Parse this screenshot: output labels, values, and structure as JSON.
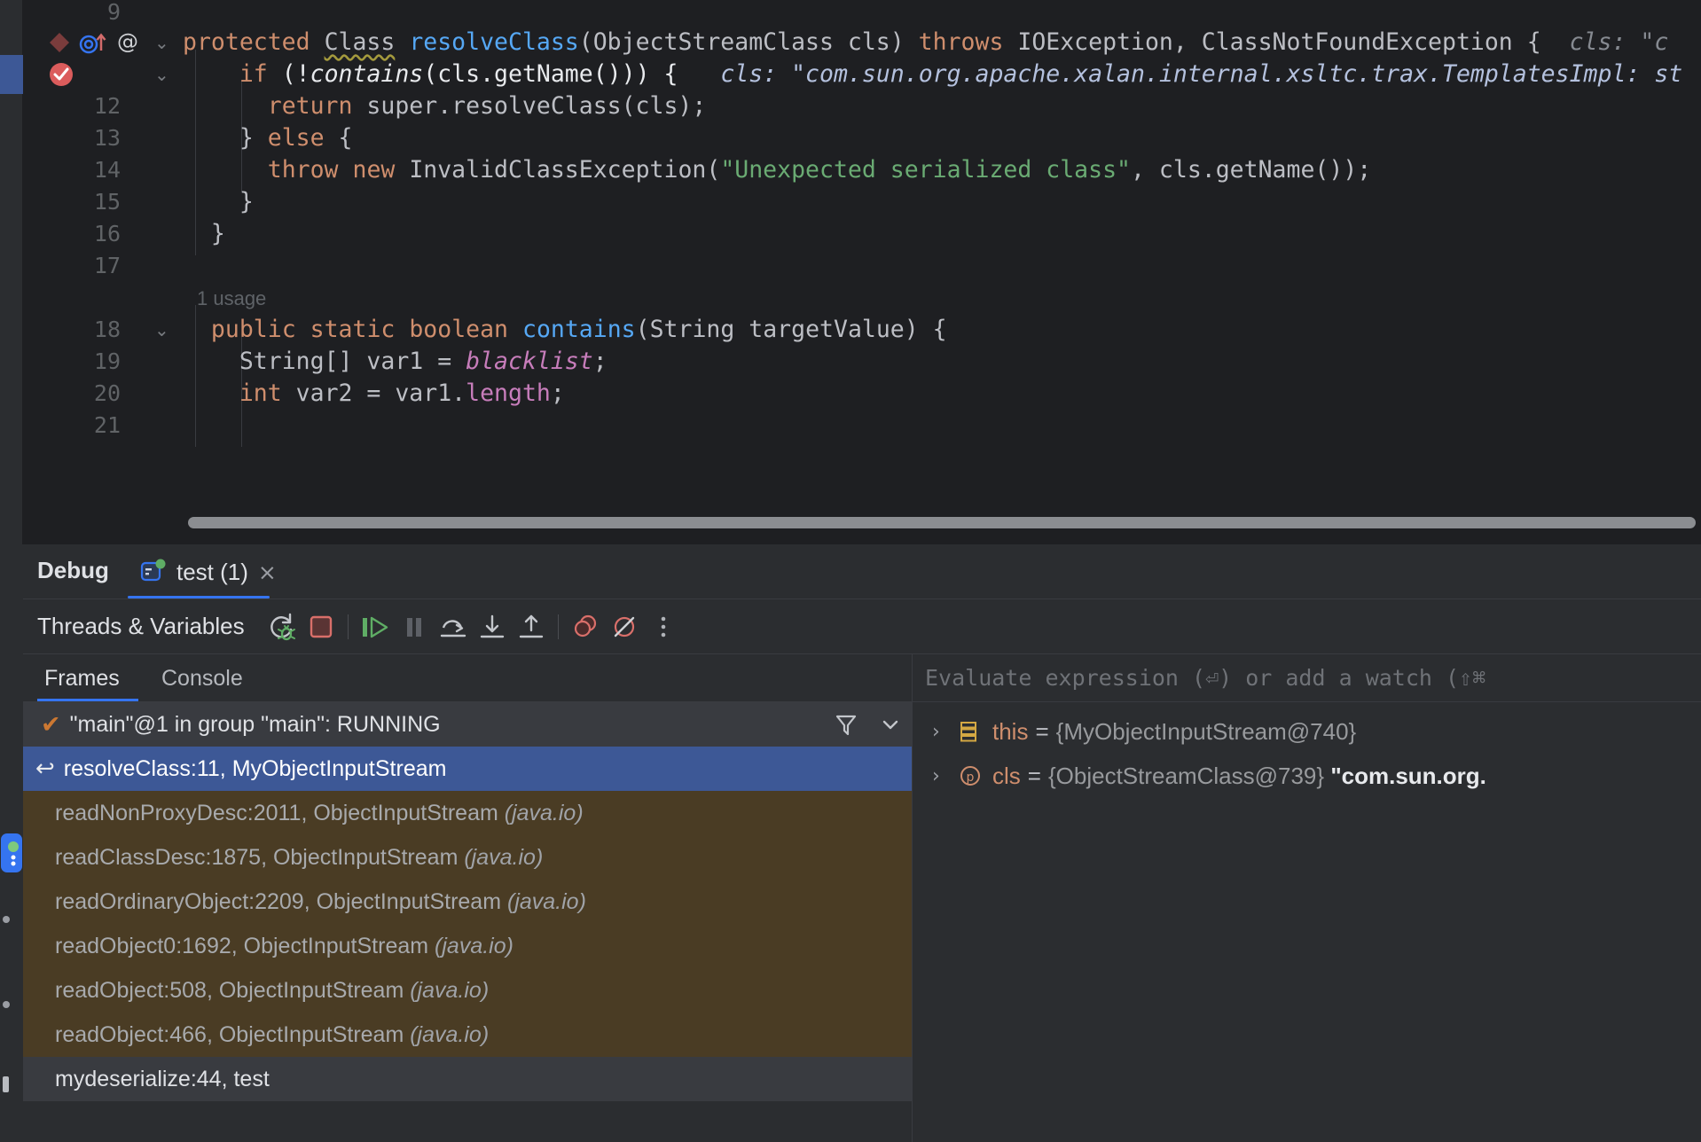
{
  "editor": {
    "lines": [
      {
        "num": "9",
        "tokens": []
      },
      {
        "num": "",
        "gutter": [
          "diamond-breakpoint-icon",
          "overriding-method-icon",
          "annotation-icon"
        ],
        "code": "protected Class resolveClass(ObjectStreamClass cls) throws IOException, ClassNotFoundException {",
        "inlay": "cls: \"c"
      },
      {
        "num": "",
        "gutter": [
          "breakpoint-verified-icon"
        ],
        "code": "if (!contains(cls.getName())) {",
        "inlay": "cls: \"com.sun.org.apache.xalan.internal.xsltc.trax.TemplatesImpl: st",
        "selected": true
      },
      {
        "num": "12",
        "code": "return super.resolveClass(cls);"
      },
      {
        "num": "13",
        "code": "} else {"
      },
      {
        "num": "14",
        "code": "throw new InvalidClassException(\"Unexpected serialized class\", cls.getName());"
      },
      {
        "num": "15",
        "code": "}"
      },
      {
        "num": "16",
        "code": "}"
      },
      {
        "num": "17",
        "code": ""
      },
      {
        "num": "",
        "code": "1 usage"
      },
      {
        "num": "18",
        "code": "public static boolean contains(String targetValue) {"
      },
      {
        "num": "19",
        "code": "String[] var1 = blacklist;"
      },
      {
        "num": "20",
        "code": "int var2 = var1.length;"
      },
      {
        "num": "21",
        "code": ""
      }
    ],
    "usage_hint": "1 usage",
    "line_numbers": [
      "9",
      "12",
      "13",
      "14",
      "15",
      "16",
      "17",
      "18",
      "19",
      "20",
      "21"
    ],
    "code_text": {
      "l10_kw1": "protected",
      "l10_type": "Class",
      "l10_fn": "resolveClass",
      "l10_params": "(ObjectStreamClass cls) ",
      "l10_kw2": "throws",
      "l10_rest": " IOException, ClassNotFoundException {",
      "l10_inlay": "cls: \"c",
      "l11_kw": "if",
      "l11_a": " (!",
      "l11_fn": "contains",
      "l11_b": "(cls.getName())) {",
      "l11_inlay": "cls: \"com.sun.org.apache.xalan.internal.xsltc.trax.TemplatesImpl: st",
      "l12_kw": "return",
      "l12_rest": " super.resolveClass(cls);",
      "l13_a": "} ",
      "l13_kw": "else",
      "l13_b": " {",
      "l14_kw1": "throw",
      "l14_kw2": "new",
      "l14_cls": " InvalidClassException(",
      "l14_str": "\"Unexpected serialized class\"",
      "l14_rest": ", cls.getName());",
      "l15": "}",
      "l16": "}",
      "l18_kw1": "public",
      "l18_kw2": "static",
      "l18_kw3": "boolean",
      "l18_fn": "contains",
      "l18_rest": "(String targetValue) {",
      "l19_a": "String[] var1 = ",
      "l19_fld": "blacklist",
      "l19_b": ";",
      "l20_kw": "int",
      "l20_a": " var2 = var1.",
      "l20_fld": "length",
      "l20_b": ";"
    }
  },
  "debug": {
    "window_title": "Debug",
    "session_tab": {
      "label": "test (1)",
      "icon": "run-configuration-icon",
      "close": "×"
    },
    "toolbar": {
      "label": "Threads & Variables",
      "buttons": [
        {
          "name": "rerun-debug-button",
          "tooltip": "Rerun Debug"
        },
        {
          "name": "stop-button",
          "tooltip": "Stop"
        },
        {
          "name": "resume-program-button",
          "tooltip": "Resume Program"
        },
        {
          "name": "pause-program-button",
          "tooltip": "Pause Program"
        },
        {
          "name": "step-over-button",
          "tooltip": "Step Over"
        },
        {
          "name": "step-into-button",
          "tooltip": "Step Into"
        },
        {
          "name": "step-out-button",
          "tooltip": "Step Out"
        },
        {
          "name": "view-breakpoints-button",
          "tooltip": "View Breakpoints"
        },
        {
          "name": "mute-breakpoints-button",
          "tooltip": "Mute Breakpoints"
        },
        {
          "name": "more-options-button",
          "tooltip": "More"
        }
      ]
    },
    "sub_tabs": [
      {
        "label": "Frames",
        "active": true
      },
      {
        "label": "Console",
        "active": false
      }
    ],
    "thread_selector": {
      "text": "\"main\"@1 in group \"main\": RUNNING",
      "status_icon": "check-icon",
      "filter_icon": "filter-funnel-icon",
      "dropdown_icon": "chevron-down-icon"
    },
    "frames": [
      {
        "text": "resolveClass:11, MyObjectInputStream",
        "pkg": "",
        "style": "selected"
      },
      {
        "text": "readNonProxyDesc:2011, ObjectInputStream",
        "pkg": "(java.io)",
        "style": "lib"
      },
      {
        "text": "readClassDesc:1875, ObjectInputStream",
        "pkg": "(java.io)",
        "style": "lib"
      },
      {
        "text": "readOrdinaryObject:2209, ObjectInputStream",
        "pkg": "(java.io)",
        "style": "lib"
      },
      {
        "text": "readObject0:1692, ObjectInputStream",
        "pkg": "(java.io)",
        "style": "lib"
      },
      {
        "text": "readObject:508, ObjectInputStream",
        "pkg": "(java.io)",
        "style": "lib"
      },
      {
        "text": "readObject:466, ObjectInputStream",
        "pkg": "(java.io)",
        "style": "lib"
      },
      {
        "text": "mydeserialize:44, test",
        "pkg": "",
        "style": "user"
      }
    ],
    "evaluate": {
      "placeholder": "Evaluate expression (⏎) or add a watch (⇧⌘"
    },
    "variables": [
      {
        "name": "this",
        "eq": "=",
        "value": "{MyObjectInputStream@740}",
        "str": "",
        "icon": "field-group-icon",
        "arrow": "›"
      },
      {
        "name": "cls",
        "eq": "=",
        "value": "{ObjectStreamClass@739}",
        "str": "\"com.sun.org.",
        "icon": "parameter-icon",
        "arrow": "›"
      }
    ]
  },
  "colors": {
    "editor_bg": "#1e1f22",
    "panel_bg": "#2b2d30",
    "selection_blue": "#3d5896",
    "accent_blue": "#3574f0",
    "library_frame": "#4a3c24",
    "keyword_orange": "#cf8e6d",
    "method_blue": "#56a8f5",
    "string_green": "#6aab73",
    "field_purple": "#c77dbb",
    "stop_red": "#c75450",
    "run_green": "#5fad65"
  }
}
